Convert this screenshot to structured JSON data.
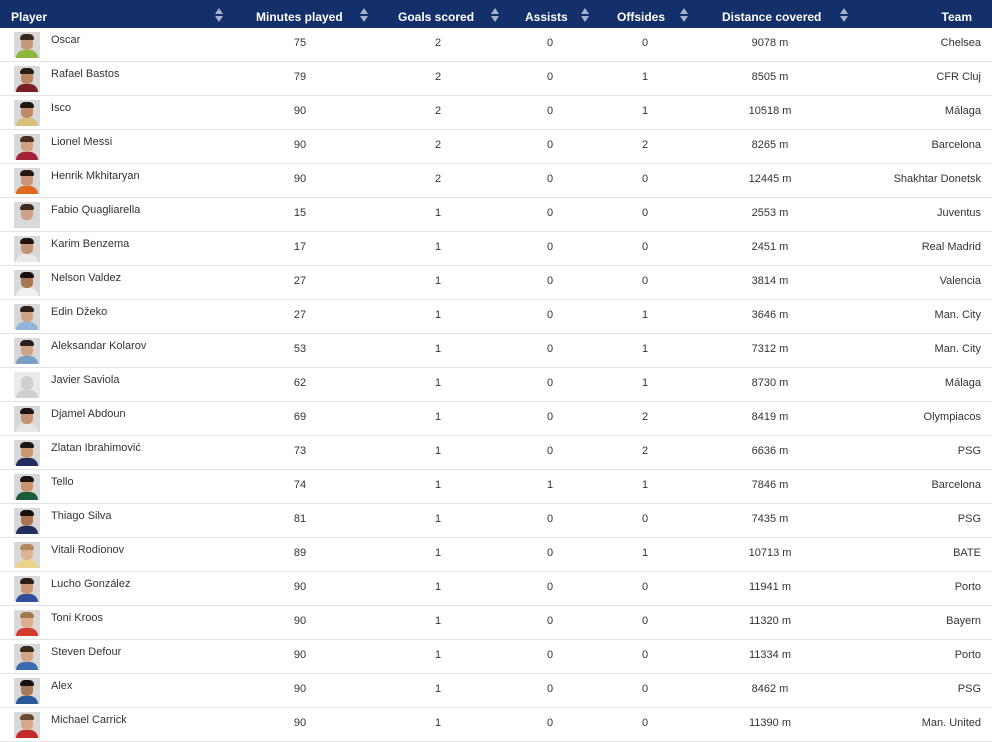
{
  "columns": {
    "player": "Player",
    "minutes": "Minutes played",
    "goals": "Goals scored",
    "assists": "Assists",
    "offsides": "Offsides",
    "distance": "Distance covered",
    "team": "Team"
  },
  "rows": [
    {
      "name": "Oscar",
      "minutes": "75",
      "goals": "2",
      "assists": "0",
      "offsides": "0",
      "distance": "9078 m",
      "team": "Chelsea",
      "skin": "#c49a78",
      "hair": "#3a2a1c",
      "shirt": "#8bb83a"
    },
    {
      "name": "Rafael Bastos",
      "minutes": "79",
      "goals": "2",
      "assists": "0",
      "offsides": "1",
      "distance": "8505 m",
      "team": "CFR Cluj",
      "skin": "#b8865f",
      "hair": "#2a1d14",
      "shirt": "#7a1f25"
    },
    {
      "name": "Isco",
      "minutes": "90",
      "goals": "2",
      "assists": "0",
      "offsides": "1",
      "distance": "10518 m",
      "team": "Málaga",
      "skin": "#c08a66",
      "hair": "#1f1610",
      "shirt": "#d8c07a"
    },
    {
      "name": "Lionel Messi",
      "minutes": "90",
      "goals": "2",
      "assists": "0",
      "offsides": "2",
      "distance": "8265 m",
      "team": "Barcelona",
      "skin": "#d3a181",
      "hair": "#4a301e",
      "shirt": "#a3223a"
    },
    {
      "name": "Henrik Mkhitaryan",
      "minutes": "90",
      "goals": "2",
      "assists": "0",
      "offsides": "0",
      "distance": "12445 m",
      "team": "Shakhtar Donetsk",
      "skin": "#c99777",
      "hair": "#24180f",
      "shirt": "#e06a1f"
    },
    {
      "name": "Fabio Quagliarella",
      "minutes": "15",
      "goals": "1",
      "assists": "0",
      "offsides": "0",
      "distance": "2553 m",
      "team": "Juventus",
      "skin": "#cfa184",
      "hair": "#3b2a1e",
      "shirt": "#d9d9d9"
    },
    {
      "name": "Karim Benzema",
      "minutes": "17",
      "goals": "1",
      "assists": "0",
      "offsides": "0",
      "distance": "2451 m",
      "team": "Real Madrid",
      "skin": "#c49574",
      "hair": "#1d140e",
      "shirt": "#e9e9e9"
    },
    {
      "name": "Nelson Valdez",
      "minutes": "27",
      "goals": "1",
      "assists": "0",
      "offsides": "0",
      "distance": "3814 m",
      "team": "Valencia",
      "skin": "#a8774f",
      "hair": "#160f0b",
      "shirt": "#f0f0f0"
    },
    {
      "name": "Edin Džeko",
      "minutes": "27",
      "goals": "1",
      "assists": "0",
      "offsides": "1",
      "distance": "3646 m",
      "team": "Man. City",
      "skin": "#cfa486",
      "hair": "#2e2219",
      "shirt": "#8fb5d8"
    },
    {
      "name": "Aleksandar Kolarov",
      "minutes": "53",
      "goals": "1",
      "assists": "0",
      "offsides": "1",
      "distance": "7312 m",
      "team": "Man. City",
      "skin": "#cfa486",
      "hair": "#2a2019",
      "shirt": "#7a9fc4"
    },
    {
      "name": "Javier Saviola",
      "minutes": "62",
      "goals": "1",
      "assists": "0",
      "offsides": "1",
      "distance": "8730 m",
      "team": "Málaga",
      "skin": "",
      "hair": "",
      "shirt": "",
      "blank": true
    },
    {
      "name": "Djamel Abdoun",
      "minutes": "69",
      "goals": "1",
      "assists": "0",
      "offsides": "2",
      "distance": "8419 m",
      "team": "Olympiacos",
      "skin": "#c69473",
      "hair": "#1c140e",
      "shirt": "#e8e8e8"
    },
    {
      "name": "Zlatan Ibrahimović",
      "minutes": "73",
      "goals": "1",
      "assists": "0",
      "offsides": "2",
      "distance": "6636 m",
      "team": "PSG",
      "skin": "#c9976f",
      "hair": "#1d150f",
      "shirt": "#1f2e5e"
    },
    {
      "name": "Tello",
      "minutes": "74",
      "goals": "1",
      "assists": "1",
      "offsides": "1",
      "distance": "7846 m",
      "team": "Barcelona",
      "skin": "#c8956f",
      "hair": "#1c140e",
      "shirt": "#1d5a3a"
    },
    {
      "name": "Thiago Silva",
      "minutes": "81",
      "goals": "1",
      "assists": "0",
      "offsides": "0",
      "distance": "7435 m",
      "team": "PSG",
      "skin": "#a77650",
      "hair": "#151009",
      "shirt": "#1f2e5e"
    },
    {
      "name": "Vitali Rodionov",
      "minutes": "89",
      "goals": "1",
      "assists": "0",
      "offsides": "1",
      "distance": "10713 m",
      "team": "BATE",
      "skin": "#dcb293",
      "hair": "#b08a5e",
      "shirt": "#e9d48a"
    },
    {
      "name": "Lucho González",
      "minutes": "90",
      "goals": "1",
      "assists": "0",
      "offsides": "0",
      "distance": "11941 m",
      "team": "Porto",
      "skin": "#c99676",
      "hair": "#2a1e15",
      "shirt": "#2f4f9a"
    },
    {
      "name": "Toni Kroos",
      "minutes": "90",
      "goals": "1",
      "assists": "0",
      "offsides": "0",
      "distance": "11320 m",
      "team": "Bayern",
      "skin": "#dcae8e",
      "hair": "#a57a4a",
      "shirt": "#d23a2a"
    },
    {
      "name": "Steven Defour",
      "minutes": "90",
      "goals": "1",
      "assists": "0",
      "offsides": "0",
      "distance": "11334 m",
      "team": "Porto",
      "skin": "#d2a585",
      "hair": "#3a2b1f",
      "shirt": "#3d6bb0"
    },
    {
      "name": "Alex",
      "minutes": "90",
      "goals": "1",
      "assists": "0",
      "offsides": "0",
      "distance": "8462 m",
      "team": "PSG",
      "skin": "#a87a55",
      "hair": "#17110b",
      "shirt": "#2a5a9c"
    },
    {
      "name": "Michael Carrick",
      "minutes": "90",
      "goals": "1",
      "assists": "0",
      "offsides": "0",
      "distance": "11390 m",
      "team": "Man. United",
      "skin": "#d8a88a",
      "hair": "#6b4a2e",
      "shirt": "#c52a2a"
    }
  ]
}
